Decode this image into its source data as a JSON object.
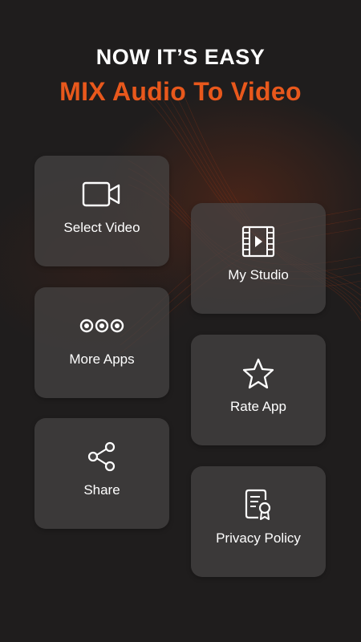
{
  "header": {
    "line1": "NOW IT’S EASY",
    "line2": "MIX Audio To Video"
  },
  "colors": {
    "accent": "#e8581c",
    "background": "#1f1d1d",
    "card": "#464444",
    "text": "#ffffff"
  },
  "menu": {
    "select_video": {
      "label": "Select Video",
      "icon": "video-camera-icon"
    },
    "my_studio": {
      "label": "My Studio",
      "icon": "film-play-icon"
    },
    "more_apps": {
      "label": "More Apps",
      "icon": "three-dots-icon"
    },
    "rate_app": {
      "label": "Rate App",
      "icon": "star-icon"
    },
    "share": {
      "label": "Share",
      "icon": "share-icon"
    },
    "privacy_policy": {
      "label": "Privacy Policy",
      "icon": "certificate-document-icon"
    }
  }
}
